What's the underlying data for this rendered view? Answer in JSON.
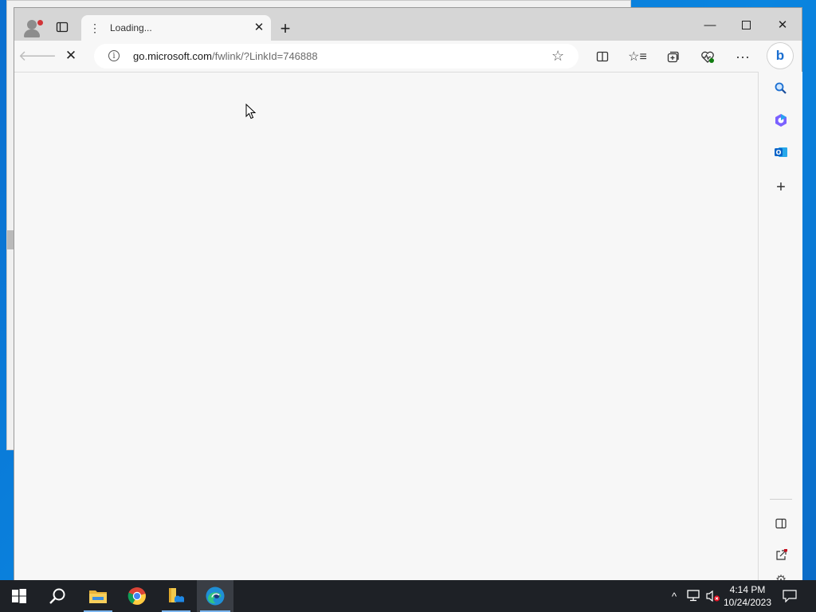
{
  "browser": {
    "tab": {
      "title": "Loading..."
    },
    "address": {
      "host": "go.microsoft.com",
      "path": "/fwlink/?LinkId=746888"
    },
    "colors": {
      "accent": "#0a78d7",
      "taskbar": "#1e2126",
      "tab_bg": "#f7f7f7",
      "titlebar": "#d6d6d6"
    },
    "toolbar_icons": [
      "split-screen-icon",
      "favorites-icon",
      "collections-icon",
      "browser-essentials-icon",
      "more-icon"
    ],
    "sidebar_icons": [
      "search-icon",
      "copilot-icon",
      "outlook-icon",
      "add-icon",
      "hide-sidebar-icon",
      "external-link-icon",
      "settings-icon"
    ]
  },
  "taskbar": {
    "apps": [
      "start-icon",
      "search-icon",
      "file-explorer-icon",
      "chrome-icon",
      "files-icon",
      "edge-icon"
    ],
    "clock": {
      "time": "4:14 PM",
      "date": "10/24/2023"
    }
  }
}
